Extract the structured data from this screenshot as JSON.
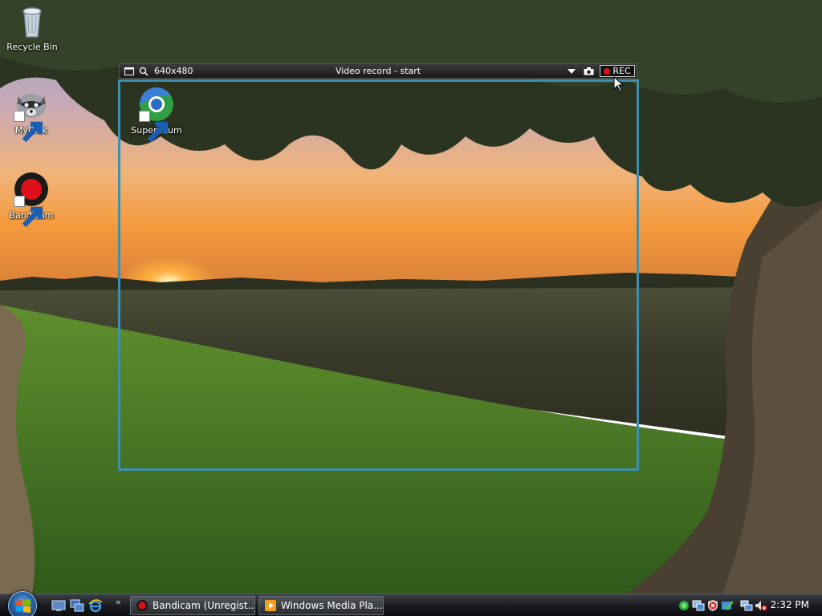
{
  "desktop": {
    "icons": [
      {
        "label": "Recycle Bin",
        "icon": "recycle-bin-icon"
      },
      {
        "label": "MyDick",
        "icon": "raccoon-icon"
      },
      {
        "label": "Bandicam",
        "icon": "bandicam-icon"
      },
      {
        "label": "Supermium",
        "icon": "supermium-browser-icon"
      }
    ]
  },
  "capture": {
    "size_label": "640x480",
    "title": "Video record - start",
    "rec_label": "REC",
    "frame_color": "#3d8fb0",
    "rec_color": "#e0101a"
  },
  "taskbar": {
    "quick_launch": [
      "show-desktop-icon",
      "switch-windows-icon",
      "internet-explorer-icon"
    ],
    "more_label": "»",
    "tasks": [
      {
        "label": "Bandicam (Unregist...",
        "icon": "bandicam-icon"
      },
      {
        "label": "Windows Media Pla...",
        "icon": "media-player-icon"
      }
    ],
    "clock": "2:32 PM"
  }
}
